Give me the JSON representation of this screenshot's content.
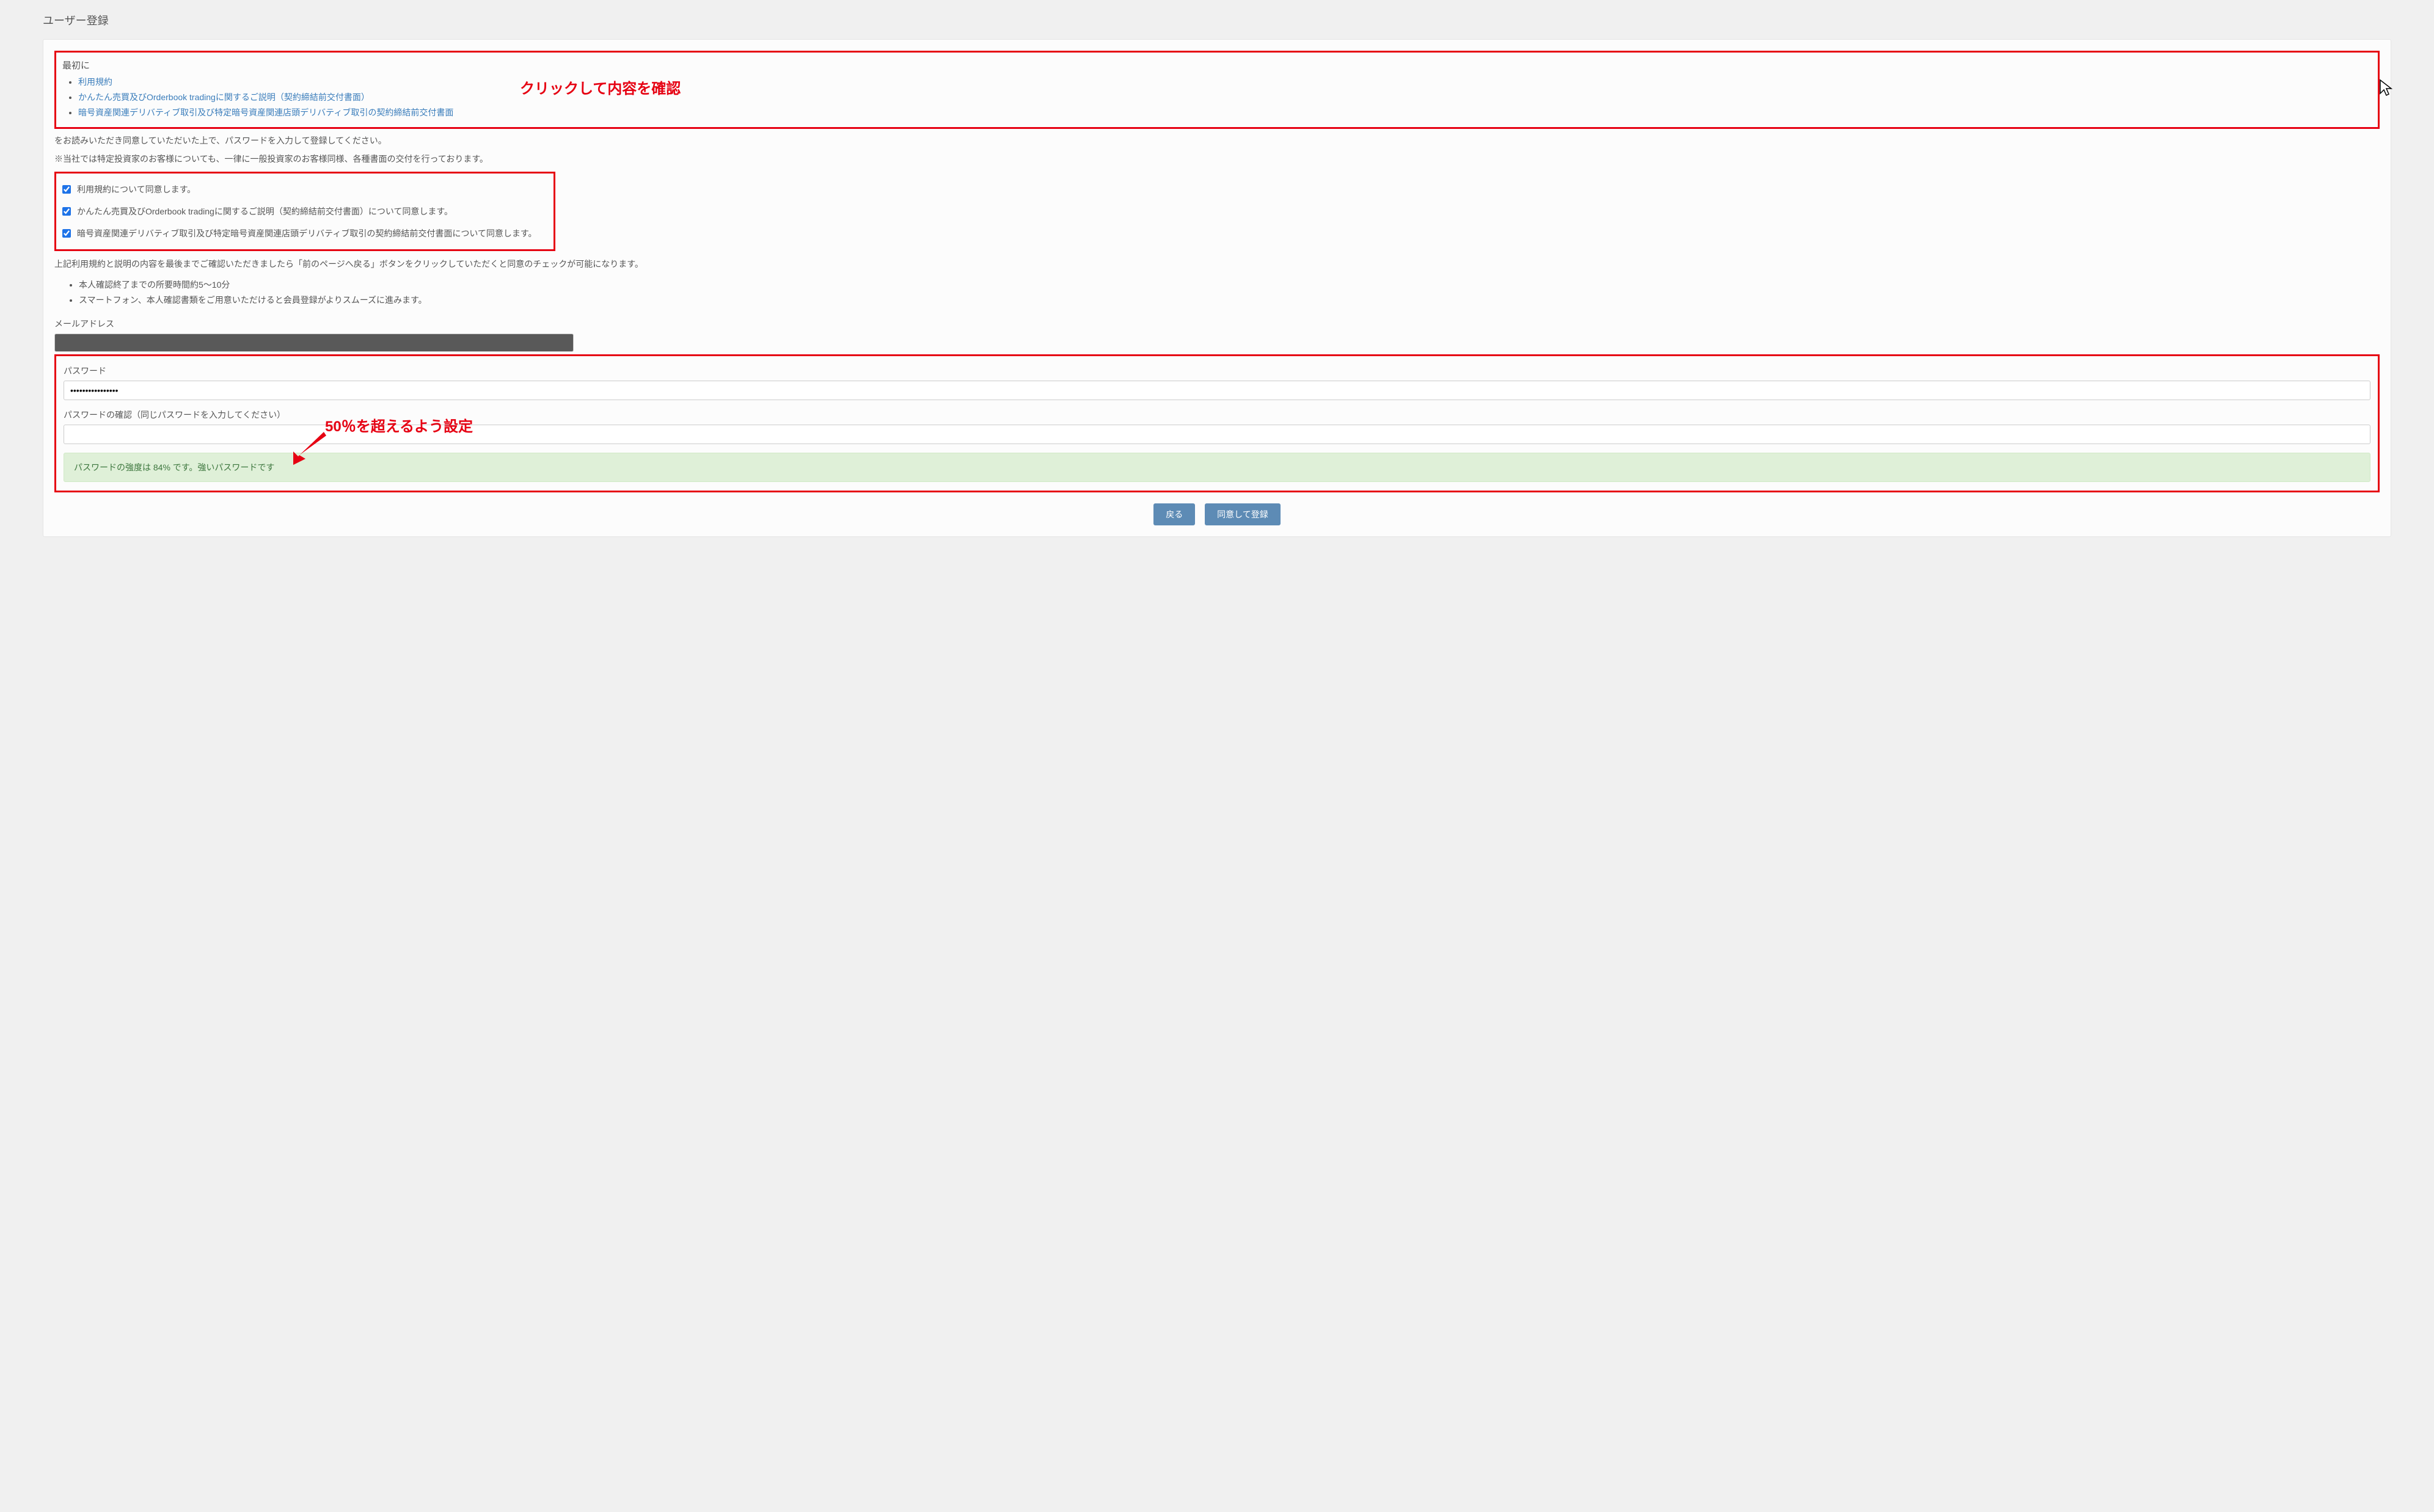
{
  "page_title": "ユーザー登録",
  "intro": {
    "heading": "最初に",
    "links": [
      "利用規約",
      "かんたん売買及びOrderbook tradingに関するご説明（契約締結前交付書面）",
      "暗号資産関連デリバティブ取引及び特定暗号資産関連店頭デリバティブ取引の契約締結前交付書面"
    ]
  },
  "callout_click": "クリックして内容を確認",
  "paragraph1": "をお読みいただき同意していただいた上で、パスワードを入力して登録してください。",
  "paragraph2": "※当社では特定投資家のお客様についても、一律に一般投資家のお客様同様、各種書面の交付を行っております。",
  "consents": [
    "利用規約について同意します。",
    "かんたん売買及びOrderbook tradingに関するご説明（契約締結前交付書面）について同意します。",
    "暗号資産関連デリバティブ取引及び特定暗号資産関連店頭デリバティブ取引の契約締結前交付書面について同意します。"
  ],
  "paragraph3": "上記利用規約と説明の内容を最後までご確認いただきましたら「前のページへ戻る」ボタンをクリックしていただくと同意のチェックが可能になります。",
  "notes": [
    "本人確認終了までの所要時間約5〜10分",
    "スマートフォン、本人確認書類をご用意いただけると会員登録がよりスムーズに進みます。"
  ],
  "email_label": "メールアドレス",
  "password_label": "パスワード",
  "password_value": "••••••••••••••••",
  "password_confirm_label": "パスワードの確認（同じパスワードを入力してください）",
  "callout_strength": "50％を超えるよう設定",
  "strength_text": "パスワードの強度は 84% です。強いパスワードです",
  "buttons": {
    "back": "戻る",
    "submit": "同意して登録"
  }
}
